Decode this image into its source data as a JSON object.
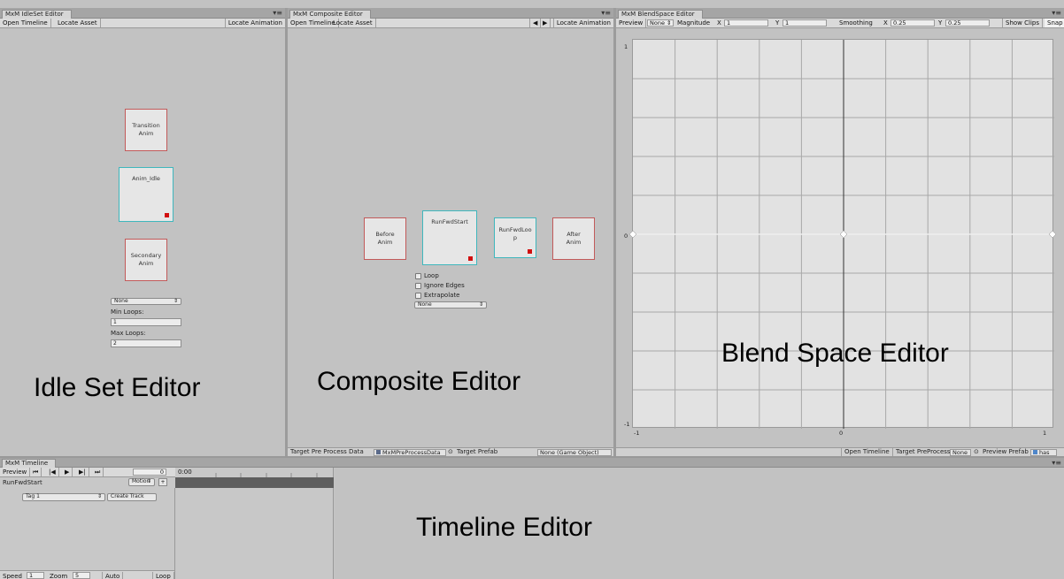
{
  "idle_editor": {
    "tab": "MxM IdleSet Editor",
    "toolbar": {
      "open_timeline": "Open Timeline",
      "locate_asset": "Locate Asset",
      "locate_animation": "Locate Animation"
    },
    "nodes": {
      "transition": [
        "Transition",
        "Anim"
      ],
      "idle": "Anim_Idle",
      "secondary": [
        "Secondary",
        "Anim"
      ]
    },
    "dropdown": "None",
    "min_loops_label": "Min Loops:",
    "min_loops_value": "1",
    "max_loops_label": "Max Loops:",
    "max_loops_value": "2",
    "caption": "Idle Set Editor"
  },
  "composite_editor": {
    "tab": "MxM Composite Editor",
    "toolbar": {
      "open_timeline": "Open Timeline",
      "locate_asset": "Locate Asset",
      "prev": "◀",
      "next": "▶",
      "locate_animation": "Locate Animation"
    },
    "nodes": {
      "before": [
        "Before",
        "Anim"
      ],
      "run_fwd_start": "RunFwdStart",
      "run_fwd_loop": [
        "RunFwdLoo",
        "p"
      ],
      "after": [
        "After",
        "Anim"
      ]
    },
    "options": {
      "loop": "Loop",
      "ignore_edges": "Ignore Edges",
      "extrapolate": "Extrapolate"
    },
    "dropdown": "None",
    "caption": "Composite Editor",
    "status": {
      "target_preprocess_label": "Target Pre Process Data",
      "target_preprocess_value": "MxMPreProcessData",
      "target_prefab_label": "Target Prefab",
      "target_prefab_value": "None (Game Object)"
    }
  },
  "blend_editor": {
    "tab": "MxM BlendSpace Editor",
    "toolbar": {
      "preview": "Preview",
      "preview_dropdown": "None",
      "magnitude_label": "Magnitude",
      "magnitude_x_label": "X",
      "magnitude_x": "1",
      "magnitude_y_label": "Y",
      "magnitude_y": "1",
      "smoothing_label": "Smoothing",
      "smoothing_x_label": "X",
      "smoothing_x": "0.25",
      "smoothing_y_label": "Y",
      "smoothing_y": "0.25",
      "show_clips": "Show Clips",
      "snap": "Snap"
    },
    "axis": {
      "y_top": "1",
      "y_mid": "0",
      "y_bottom": "-1",
      "x_left": "-1",
      "x_mid": "0",
      "x_right": "1"
    },
    "caption": "Blend Space Editor",
    "status": {
      "open_timeline": "Open Timeline",
      "target_preprocess_label": "Target PreProcess",
      "target_preprocess_value": "None",
      "preview_prefab_label": "Preview Prefab",
      "preview_prefab_value": "has"
    }
  },
  "timeline_editor": {
    "tab": "MxM Timeline",
    "toolbar": {
      "preview": "Preview",
      "first": "⏮",
      "prev_frame": "|◀",
      "play": "▶",
      "next_frame": "▶|",
      "last": "⏭",
      "frame": "0",
      "time": "0:00"
    },
    "clip_name": "RunFwdStart",
    "motion_dropdown": "Motion",
    "tag_dropdown": "Tag 1",
    "create_track": "Create Track",
    "bottom": {
      "speed_label": "Speed",
      "speed_value": "1",
      "zoom_label": "Zoom",
      "zoom_value": "5",
      "auto": "Auto",
      "loop": "Loop"
    },
    "caption": "Timeline Editor"
  }
}
